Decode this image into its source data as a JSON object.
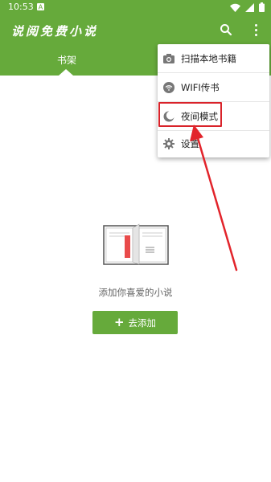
{
  "status": {
    "time": "10:53"
  },
  "app": {
    "title": "说阅免费小说"
  },
  "tabs": [
    {
      "label": "书架"
    }
  ],
  "menu": {
    "items": [
      {
        "label": "扫描本地书籍",
        "icon": "camera-icon"
      },
      {
        "label": "WIFI传书",
        "icon": "wifi-icon"
      },
      {
        "label": "夜间模式",
        "icon": "moon-icon"
      },
      {
        "label": "设置",
        "icon": "gear-icon"
      }
    ]
  },
  "empty": {
    "message": "添加你喜爱的小说",
    "add_label": "去添加"
  },
  "colors": {
    "primary": "#66aa3b",
    "annotation": "#d9232a"
  }
}
